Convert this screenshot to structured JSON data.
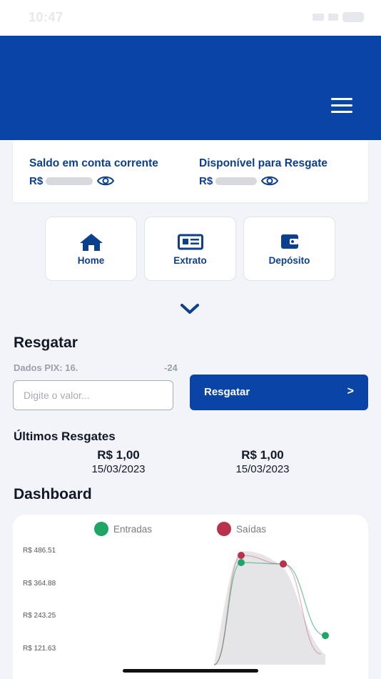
{
  "status_bar": {
    "time": "10:47"
  },
  "balance": {
    "checking_title": "Saldo em conta corrente",
    "available_title": "Disponível para Resgate",
    "currency": "R$"
  },
  "nav": [
    {
      "label": "Home",
      "icon": "home-icon"
    },
    {
      "label": "Extrato",
      "icon": "newspaper-icon"
    },
    {
      "label": "Depósito",
      "icon": "wallet-icon"
    }
  ],
  "redeem": {
    "title": "Resgatar",
    "pix_label": "Dados PIX: 16.",
    "pix_suffix": "-24",
    "input_placeholder": "Digite o valor...",
    "button_label": "Resgatar",
    "button_arrow": ">"
  },
  "last_redemptions": {
    "title": "Últimos Resgates",
    "items": [
      {
        "value": "R$ 1,00",
        "date": "15/03/2023"
      },
      {
        "value": "R$ 1,00",
        "date": "15/03/2023"
      }
    ]
  },
  "dashboard": {
    "title": "Dashboard"
  },
  "colors": {
    "primary": "#0a44a6",
    "entradas": "#1fa667",
    "saidas": "#b8324b"
  },
  "chart_data": {
    "type": "area",
    "series": [
      {
        "name": "Entradas",
        "values": [
          null,
          441,
          436,
          170
        ]
      },
      {
        "name": "Saídas",
        "values": [
          null,
          468,
          436,
          null
        ]
      }
    ],
    "y_ticks": [
      "R$ 486.51",
      "R$ 364.88",
      "R$ 243.25",
      "R$ 121.63"
    ],
    "y_tick_values": [
      486.51,
      364.88,
      243.25,
      121.63
    ],
    "legend": [
      "Entradas",
      "Saídas"
    ],
    "legend_position": "top"
  }
}
